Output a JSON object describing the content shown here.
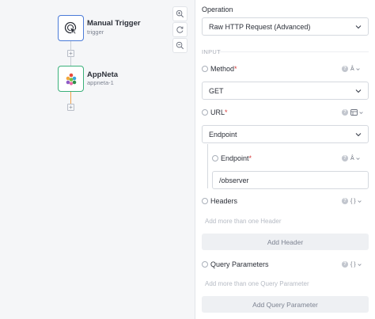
{
  "canvas": {
    "nodes": [
      {
        "title": "Manual Trigger",
        "subtitle": "trigger",
        "icon": "pointer-click-icon"
      },
      {
        "title": "AppNeta",
        "subtitle": "appneta-1",
        "icon": "appneta-logo-icon"
      }
    ],
    "controls": [
      "zoom-in-icon",
      "refresh-icon",
      "zoom-out-icon"
    ],
    "colors": {
      "trigger_border": "#4b7bd8",
      "appneta_border": "#3ab07a",
      "connector_active": "#f0a14a"
    }
  },
  "panel": {
    "operation": {
      "label": "Operation",
      "value": "Raw HTTP Request (Advanced)"
    },
    "section_input": "INPUT",
    "method": {
      "label": "Method",
      "required_mark": "*",
      "type_symbol": "Â",
      "value": "GET"
    },
    "url": {
      "label": "URL",
      "required_mark": "*",
      "value": "Endpoint",
      "endpoint": {
        "label": "Endpoint",
        "required_mark": "*",
        "type_symbol": "Â",
        "value": "/observer"
      }
    },
    "headers": {
      "label": "Headers",
      "type_symbol": "{ }",
      "placeholder": "Add more than one Header",
      "add_label": "Add Header"
    },
    "query_parameters": {
      "label": "Query Parameters",
      "type_symbol": "{ }",
      "placeholder": "Add more than one Query Parameter",
      "add_label": "Add Query Parameter"
    },
    "help_symbol": "?"
  }
}
